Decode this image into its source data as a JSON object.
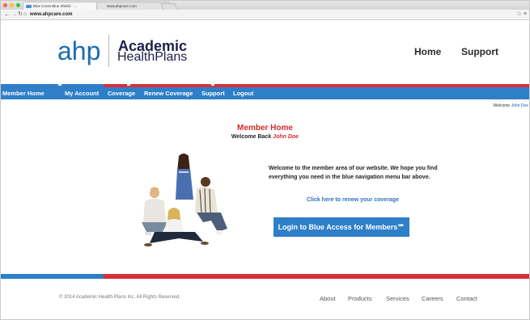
{
  "browser": {
    "tabs": [
      {
        "label": "Blue Cross Blue Shield - ...",
        "active": true
      },
      {
        "label": "www.ahpcare.com",
        "active": false
      }
    ],
    "url": "www.ahpcare.com",
    "back_icon": "back-arrow-icon",
    "forward_icon": "forward-arrow-icon",
    "reload_icon": "reload-icon",
    "home_icon": "home-icon"
  },
  "header": {
    "logo_mark": "ahp",
    "logo_line1": "Academic",
    "logo_line2": "HealthPlans",
    "nav": [
      "Home",
      "Support"
    ]
  },
  "navbar": {
    "items": [
      "Member Home",
      "My Account",
      "Coverage",
      "Renew Coverage",
      "Support",
      "Logout"
    ],
    "color": "#2e7ec8"
  },
  "welcome_corner": {
    "prefix": "Welcome",
    "name": "John Doe"
  },
  "main": {
    "title": "Member Home",
    "subtitle_prefix": "Welcome Back",
    "subtitle_name": "John Doe",
    "intro": "Welcome to the member area of our website. We hope you find everything you need in the blue navigation menu bar above.",
    "renew_link": "Click here to renew your coverage",
    "login_button": "Login to Blue Access for Members℠"
  },
  "footer": {
    "copyright": "© 2014 Academic Health Plans Inc. All Rights Reserved.",
    "links": [
      "About",
      "Products",
      "Services",
      "Careers",
      "Contact"
    ]
  },
  "colors": {
    "accent_red": "#d52b2b",
    "brand_blue": "#2e7ec8",
    "link_blue": "#2f6fc0"
  }
}
